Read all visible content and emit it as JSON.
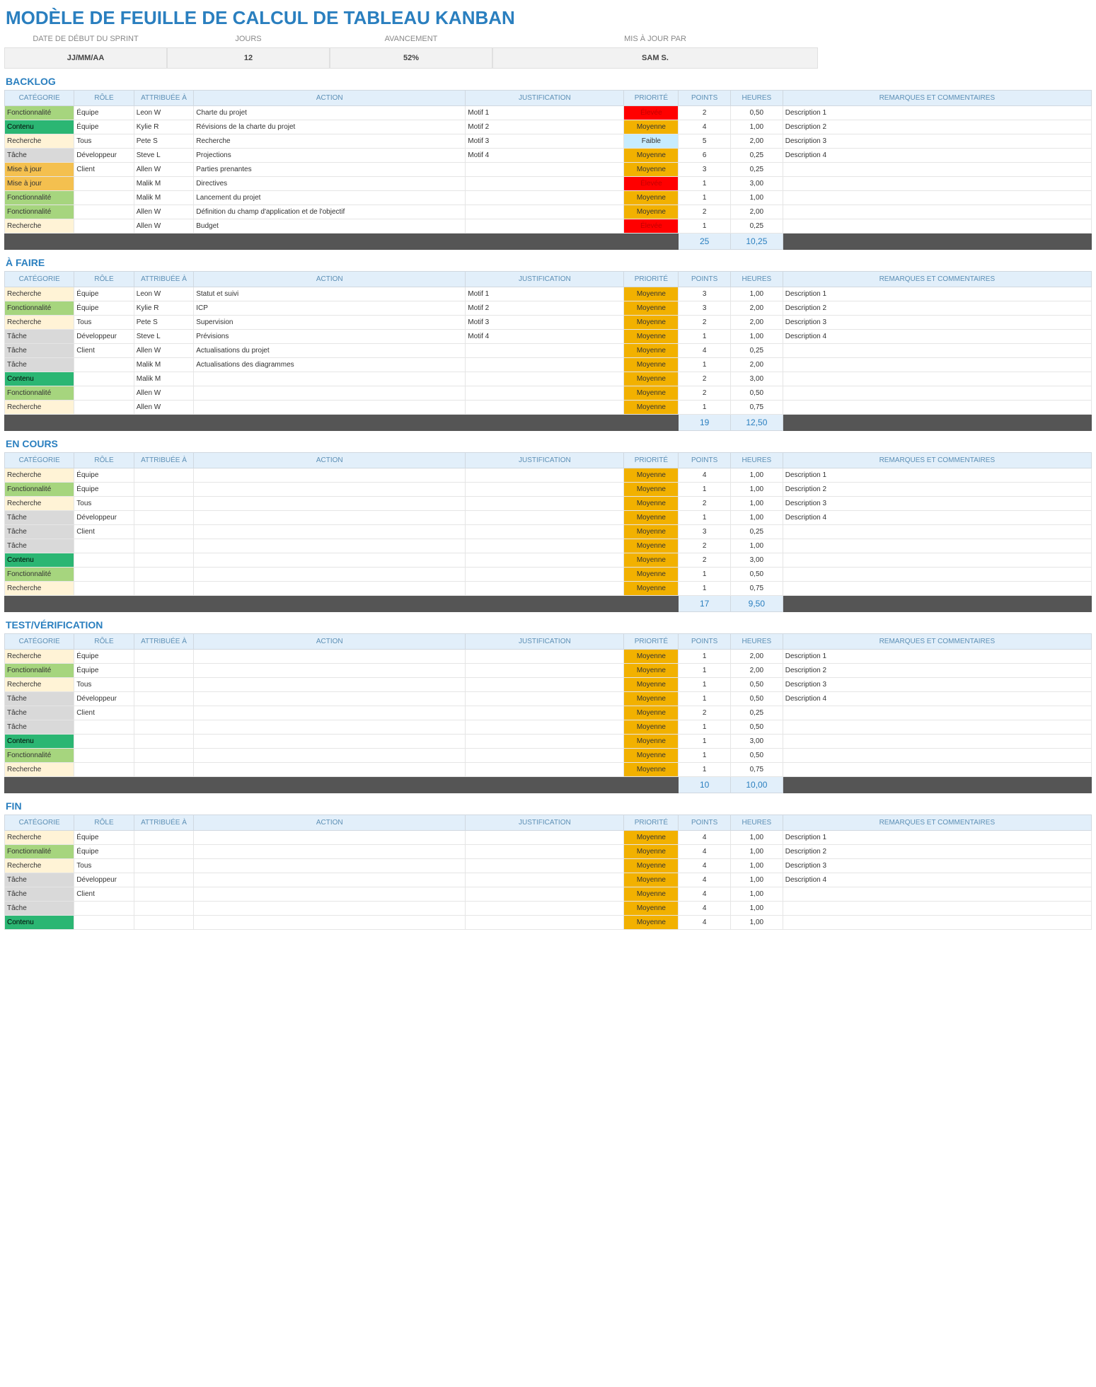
{
  "title": "MODÈLE DE FEUILLE DE CALCUL DE TABLEAU KANBAN",
  "info": {
    "labels": [
      "DATE DE DÉBUT DU SPRINT",
      "JOURS",
      "AVANCEMENT",
      "MIS À JOUR PAR"
    ],
    "values": [
      "JJ/MM/AA",
      "12",
      "52%",
      "SAM S."
    ]
  },
  "headers": [
    "CATÉGORIE",
    "RÔLE",
    "ATTRIBUÉE À",
    "ACTION",
    "JUSTIFICATION",
    "PRIORITÉ",
    "POINTS",
    "HEURES",
    "REMARQUES ET COMMENTAIRES"
  ],
  "categoryClass": {
    "Recherche": "cat-Recherche",
    "Fonctionnalité": "cat-Fonctionnalite",
    "Contenu": "cat-Contenu",
    "Tâche": "cat-Tache",
    "Mise à jour": "cat-Miseajour"
  },
  "priorityClass": {
    "Moyenne": "pri-Moyenne",
    "Élevée": "pri-Elevee",
    "Faible": "pri-Faible"
  },
  "sections": [
    {
      "title": "BACKLOG",
      "totals": {
        "points": "25",
        "hours": "10,25"
      },
      "rows": [
        {
          "cat": "Fonctionnalité",
          "role": "Équipe",
          "assign": "Leon W",
          "action": "Charte du projet",
          "just": "Motif 1",
          "pri": "Élevée",
          "pts": "2",
          "hrs": "0,50",
          "rem": "Description 1"
        },
        {
          "cat": "Contenu",
          "role": "Équipe",
          "assign": "Kylie R",
          "action": "Révisions de la charte du projet",
          "just": "Motif 2",
          "pri": "Moyenne",
          "pts": "4",
          "hrs": "1,00",
          "rem": "Description 2"
        },
        {
          "cat": "Recherche",
          "role": "Tous",
          "assign": "Pete S",
          "action": "Recherche",
          "just": "Motif 3",
          "pri": "Faible",
          "pts": "5",
          "hrs": "2,00",
          "rem": "Description 3"
        },
        {
          "cat": "Tâche",
          "role": "Développeur",
          "assign": "Steve L",
          "action": "Projections",
          "just": "Motif 4",
          "pri": "Moyenne",
          "pts": "6",
          "hrs": "0,25",
          "rem": "Description 4"
        },
        {
          "cat": "Mise à jour",
          "role": "Client",
          "assign": "Allen W",
          "action": "Parties prenantes",
          "just": "",
          "pri": "Moyenne",
          "pts": "3",
          "hrs": "0,25",
          "rem": ""
        },
        {
          "cat": "Mise à jour",
          "role": "",
          "assign": "Malik M",
          "action": "Directives",
          "just": "",
          "pri": "Élevée",
          "pts": "1",
          "hrs": "3,00",
          "rem": ""
        },
        {
          "cat": "Fonctionnalité",
          "role": "",
          "assign": "Malik M",
          "action": "Lancement du projet",
          "just": "",
          "pri": "Moyenne",
          "pts": "1",
          "hrs": "1,00",
          "rem": ""
        },
        {
          "cat": "Fonctionnalité",
          "role": "",
          "assign": "Allen W",
          "action": "Définition du champ d'application et de l'objectif",
          "just": "",
          "pri": "Moyenne",
          "pts": "2",
          "hrs": "2,00",
          "rem": ""
        },
        {
          "cat": "Recherche",
          "role": "",
          "assign": "Allen W",
          "action": "Budget",
          "just": "",
          "pri": "Élevée",
          "pts": "1",
          "hrs": "0,25",
          "rem": ""
        }
      ]
    },
    {
      "title": "À FAIRE",
      "totals": {
        "points": "19",
        "hours": "12,50"
      },
      "rows": [
        {
          "cat": "Recherche",
          "role": "Équipe",
          "assign": "Leon W",
          "action": "Statut et suivi",
          "just": "Motif 1",
          "pri": "Moyenne",
          "pts": "3",
          "hrs": "1,00",
          "rem": "Description 1"
        },
        {
          "cat": "Fonctionnalité",
          "role": "Équipe",
          "assign": "Kylie R",
          "action": "ICP",
          "just": "Motif 2",
          "pri": "Moyenne",
          "pts": "3",
          "hrs": "2,00",
          "rem": "Description 2"
        },
        {
          "cat": "Recherche",
          "role": "Tous",
          "assign": "Pete S",
          "action": "Supervision",
          "just": "Motif 3",
          "pri": "Moyenne",
          "pts": "2",
          "hrs": "2,00",
          "rem": "Description 3"
        },
        {
          "cat": "Tâche",
          "role": "Développeur",
          "assign": "Steve L",
          "action": "Prévisions",
          "just": "Motif 4",
          "pri": "Moyenne",
          "pts": "1",
          "hrs": "1,00",
          "rem": "Description 4"
        },
        {
          "cat": "Tâche",
          "role": "Client",
          "assign": "Allen W",
          "action": "Actualisations du projet",
          "just": "",
          "pri": "Moyenne",
          "pts": "4",
          "hrs": "0,25",
          "rem": ""
        },
        {
          "cat": "Tâche",
          "role": "",
          "assign": "Malik M",
          "action": "Actualisations des diagrammes",
          "just": "",
          "pri": "Moyenne",
          "pts": "1",
          "hrs": "2,00",
          "rem": ""
        },
        {
          "cat": "Contenu",
          "role": "",
          "assign": "Malik M",
          "action": "",
          "just": "",
          "pri": "Moyenne",
          "pts": "2",
          "hrs": "3,00",
          "rem": ""
        },
        {
          "cat": "Fonctionnalité",
          "role": "",
          "assign": "Allen W",
          "action": "",
          "just": "",
          "pri": "Moyenne",
          "pts": "2",
          "hrs": "0,50",
          "rem": ""
        },
        {
          "cat": "Recherche",
          "role": "",
          "assign": "Allen W",
          "action": "",
          "just": "",
          "pri": "Moyenne",
          "pts": "1",
          "hrs": "0,75",
          "rem": ""
        }
      ]
    },
    {
      "title": "EN COURS",
      "totals": {
        "points": "17",
        "hours": "9,50"
      },
      "rows": [
        {
          "cat": "Recherche",
          "role": "Équipe",
          "assign": "",
          "action": "",
          "just": "",
          "pri": "Moyenne",
          "pts": "4",
          "hrs": "1,00",
          "rem": "Description 1"
        },
        {
          "cat": "Fonctionnalité",
          "role": "Équipe",
          "assign": "",
          "action": "",
          "just": "",
          "pri": "Moyenne",
          "pts": "1",
          "hrs": "1,00",
          "rem": "Description 2"
        },
        {
          "cat": "Recherche",
          "role": "Tous",
          "assign": "",
          "action": "",
          "just": "",
          "pri": "Moyenne",
          "pts": "2",
          "hrs": "1,00",
          "rem": "Description 3"
        },
        {
          "cat": "Tâche",
          "role": "Développeur",
          "assign": "",
          "action": "",
          "just": "",
          "pri": "Moyenne",
          "pts": "1",
          "hrs": "1,00",
          "rem": "Description 4"
        },
        {
          "cat": "Tâche",
          "role": "Client",
          "assign": "",
          "action": "",
          "just": "",
          "pri": "Moyenne",
          "pts": "3",
          "hrs": "0,25",
          "rem": ""
        },
        {
          "cat": "Tâche",
          "role": "",
          "assign": "",
          "action": "",
          "just": "",
          "pri": "Moyenne",
          "pts": "2",
          "hrs": "1,00",
          "rem": ""
        },
        {
          "cat": "Contenu",
          "role": "",
          "assign": "",
          "action": "",
          "just": "",
          "pri": "Moyenne",
          "pts": "2",
          "hrs": "3,00",
          "rem": ""
        },
        {
          "cat": "Fonctionnalité",
          "role": "",
          "assign": "",
          "action": "",
          "just": "",
          "pri": "Moyenne",
          "pts": "1",
          "hrs": "0,50",
          "rem": ""
        },
        {
          "cat": "Recherche",
          "role": "",
          "assign": "",
          "action": "",
          "just": "",
          "pri": "Moyenne",
          "pts": "1",
          "hrs": "0,75",
          "rem": ""
        }
      ]
    },
    {
      "title": "TEST/VÉRIFICATION",
      "totals": {
        "points": "10",
        "hours": "10,00"
      },
      "rows": [
        {
          "cat": "Recherche",
          "role": "Équipe",
          "assign": "",
          "action": "",
          "just": "",
          "pri": "Moyenne",
          "pts": "1",
          "hrs": "2,00",
          "rem": "Description 1"
        },
        {
          "cat": "Fonctionnalité",
          "role": "Équipe",
          "assign": "",
          "action": "",
          "just": "",
          "pri": "Moyenne",
          "pts": "1",
          "hrs": "2,00",
          "rem": "Description 2"
        },
        {
          "cat": "Recherche",
          "role": "Tous",
          "assign": "",
          "action": "",
          "just": "",
          "pri": "Moyenne",
          "pts": "1",
          "hrs": "0,50",
          "rem": "Description 3"
        },
        {
          "cat": "Tâche",
          "role": "Développeur",
          "assign": "",
          "action": "",
          "just": "",
          "pri": "Moyenne",
          "pts": "1",
          "hrs": "0,50",
          "rem": "Description 4"
        },
        {
          "cat": "Tâche",
          "role": "Client",
          "assign": "",
          "action": "",
          "just": "",
          "pri": "Moyenne",
          "pts": "2",
          "hrs": "0,25",
          "rem": ""
        },
        {
          "cat": "Tâche",
          "role": "",
          "assign": "",
          "action": "",
          "just": "",
          "pri": "Moyenne",
          "pts": "1",
          "hrs": "0,50",
          "rem": ""
        },
        {
          "cat": "Contenu",
          "role": "",
          "assign": "",
          "action": "",
          "just": "",
          "pri": "Moyenne",
          "pts": "1",
          "hrs": "3,00",
          "rem": ""
        },
        {
          "cat": "Fonctionnalité",
          "role": "",
          "assign": "",
          "action": "",
          "just": "",
          "pri": "Moyenne",
          "pts": "1",
          "hrs": "0,50",
          "rem": ""
        },
        {
          "cat": "Recherche",
          "role": "",
          "assign": "",
          "action": "",
          "just": "",
          "pri": "Moyenne",
          "pts": "1",
          "hrs": "0,75",
          "rem": ""
        }
      ]
    },
    {
      "title": "FIN",
      "totals": null,
      "rows": [
        {
          "cat": "Recherche",
          "role": "Équipe",
          "assign": "",
          "action": "",
          "just": "",
          "pri": "Moyenne",
          "pts": "4",
          "hrs": "1,00",
          "rem": "Description 1"
        },
        {
          "cat": "Fonctionnalité",
          "role": "Équipe",
          "assign": "",
          "action": "",
          "just": "",
          "pri": "Moyenne",
          "pts": "4",
          "hrs": "1,00",
          "rem": "Description 2"
        },
        {
          "cat": "Recherche",
          "role": "Tous",
          "assign": "",
          "action": "",
          "just": "",
          "pri": "Moyenne",
          "pts": "4",
          "hrs": "1,00",
          "rem": "Description 3"
        },
        {
          "cat": "Tâche",
          "role": "Développeur",
          "assign": "",
          "action": "",
          "just": "",
          "pri": "Moyenne",
          "pts": "4",
          "hrs": "1,00",
          "rem": "Description 4"
        },
        {
          "cat": "Tâche",
          "role": "Client",
          "assign": "",
          "action": "",
          "just": "",
          "pri": "Moyenne",
          "pts": "4",
          "hrs": "1,00",
          "rem": ""
        },
        {
          "cat": "Tâche",
          "role": "",
          "assign": "",
          "action": "",
          "just": "",
          "pri": "Moyenne",
          "pts": "4",
          "hrs": "1,00",
          "rem": ""
        },
        {
          "cat": "Contenu",
          "role": "",
          "assign": "",
          "action": "",
          "just": "",
          "pri": "Moyenne",
          "pts": "4",
          "hrs": "1,00",
          "rem": ""
        }
      ]
    }
  ]
}
